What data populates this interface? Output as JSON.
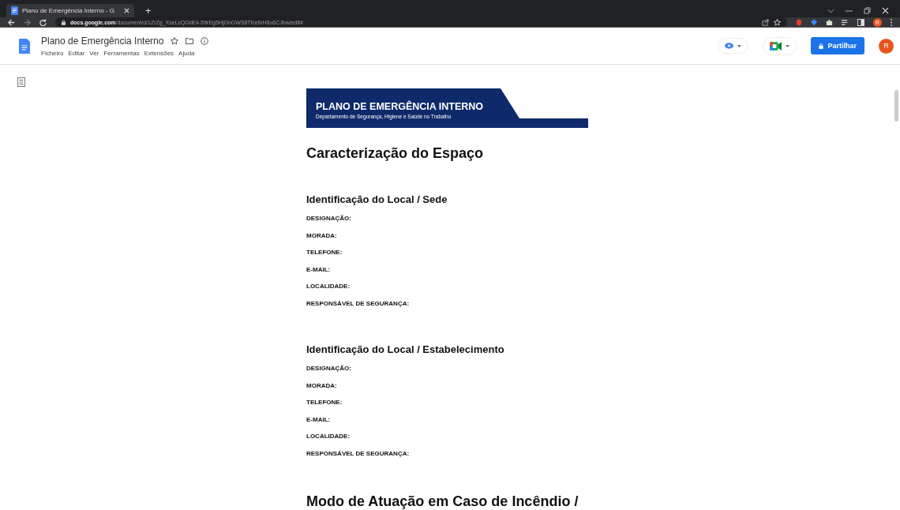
{
  "browser": {
    "tab_title": "Plano de Emergência Interno - G",
    "new_tab": "+",
    "url_host": "docs.google.com",
    "url_path": "/document/d/1ZrZg_XseLcQOdEk-59rEg5HjOnGWS8TKe6rH8o6CJbw/edit#",
    "profile": "R"
  },
  "doc_header": {
    "title": "Plano de Emergência Interno",
    "menu": [
      "Ficheiro",
      "Editar",
      "Ver",
      "Ferramentas",
      "Extensões",
      "Ajuda"
    ],
    "share": "Partilhar",
    "avatar": "R"
  },
  "document": {
    "banner": {
      "title": "PLANO DE EMERGÊNCIA INTERNO",
      "subtitle": "Departamento de Segurança, Higiene e Saúde no Trabalho"
    },
    "heading": "Caracterização do Espaço",
    "sections": [
      {
        "title": "Identificação do Local / Sede",
        "fields": [
          "DESIGNAÇÃO:",
          "MORADA:",
          "TELEFONE:",
          "E-MAIL:",
          "LOCALIDADE:",
          "RESPONSÁVEL DE SEGURANÇA:"
        ]
      },
      {
        "title": "Identificação do Local / Estabelecimento",
        "fields": [
          "DESIGNAÇÃO:",
          "MORADA:",
          "TELEFONE:",
          "E-MAIL:",
          "LOCALIDADE:",
          "RESPONSÁVEL DE SEGURANÇA:"
        ]
      }
    ],
    "next_heading": "Modo de Atuação em Caso de Incêndio /"
  }
}
